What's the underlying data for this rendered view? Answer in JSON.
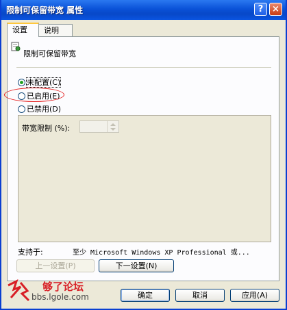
{
  "window": {
    "title": "限制可保留带宽 属性",
    "help_label": "?",
    "close_label": "×"
  },
  "tabs": [
    {
      "label": "设置",
      "active": true
    },
    {
      "label": "说明",
      "active": false
    }
  ],
  "policy": {
    "title": "限制可保留带宽",
    "options": [
      {
        "label": "未配置",
        "shortcut": "(C)",
        "selected": true
      },
      {
        "label": "已启用",
        "shortcut": "(E)",
        "selected": false
      },
      {
        "label": "已禁用",
        "shortcut": "(D)",
        "selected": false
      }
    ],
    "bandwidth_label": "带宽限制 (%):",
    "bandwidth_value": ""
  },
  "support": {
    "label": "支持于:",
    "value": "至少 Microsoft Windows XP Professional 或..."
  },
  "nav": {
    "prev_label": "上一设置(P)",
    "next_label": "下一设置(N)"
  },
  "footer": {
    "ok_label": "确定",
    "cancel_label": "取消",
    "apply_label": "应用(A)"
  },
  "watermark": {
    "name": "够了论坛",
    "url": "bbs.lgole.com"
  },
  "colors": {
    "titlebar": "#0a52d8",
    "dialog_bg": "#ece9d8",
    "annotation": "#e41c1c",
    "watermark": "#d81f26"
  }
}
